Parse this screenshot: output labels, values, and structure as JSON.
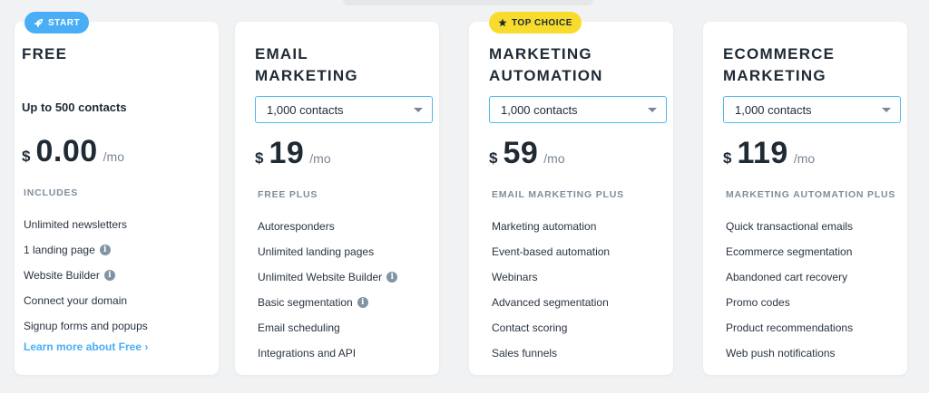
{
  "plans": [
    {
      "badge": "START",
      "title_line1": "FREE",
      "contacts": "Up to 500 contacts",
      "currency": "$",
      "price": "0.00",
      "period": "/mo",
      "section": "INCLUDES",
      "features": [
        "Unlimited newsletters",
        "1 landing page",
        "Website Builder",
        "Connect your domain",
        "Signup forms and popups"
      ],
      "learn_more": "Learn more about Free ›"
    },
    {
      "title_line1": "EMAIL",
      "title_line2": "MARKETING",
      "contacts_select": "1,000 contacts",
      "currency": "$",
      "price": "19",
      "period": "/mo",
      "section": "FREE PLUS",
      "features": [
        "Autoresponders",
        "Unlimited landing pages",
        "Unlimited Website Builder",
        "Basic segmentation",
        "Email scheduling",
        "Integrations and API"
      ]
    },
    {
      "badge": "TOP CHOICE",
      "title_line1": "MARKETING",
      "title_line2": "AUTOMATION",
      "contacts_select": "1,000 contacts",
      "currency": "$",
      "price": "59",
      "period": "/mo",
      "section": "EMAIL MARKETING PLUS",
      "features": [
        "Marketing automation",
        "Event-based automation",
        "Webinars",
        "Advanced segmentation",
        "Contact scoring",
        "Sales funnels"
      ]
    },
    {
      "title_line1": "ECOMMERCE",
      "title_line2": "MARKETING",
      "contacts_select": "1,000 contacts",
      "currency": "$",
      "price": "119",
      "period": "/mo",
      "section": "MARKETING AUTOMATION PLUS",
      "features": [
        "Quick transactional emails",
        "Ecommerce segmentation",
        "Abandoned cart recovery",
        "Promo codes",
        "Product recommendations",
        "Web push notifications"
      ]
    }
  ],
  "colors": {
    "accent": "#4aaef6",
    "top_choice": "#f7dc2e",
    "select_border": "#4fb8ea"
  },
  "icons": [
    "rocket-icon",
    "star-icon",
    "info-icon",
    "chevron-down-icon"
  ]
}
